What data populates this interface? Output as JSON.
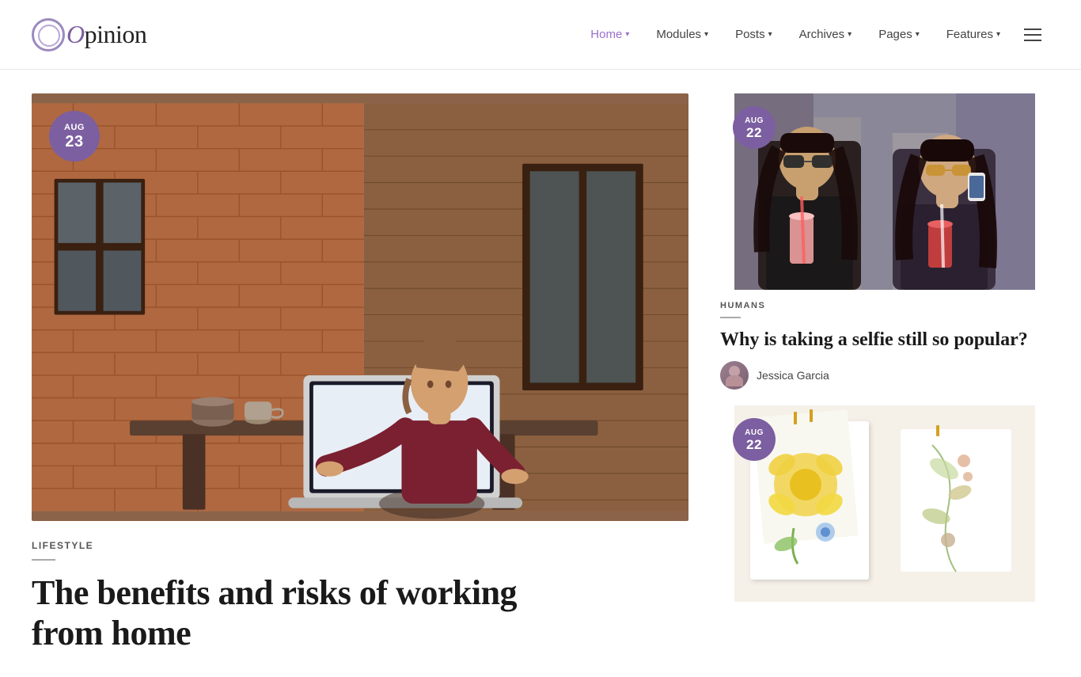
{
  "site": {
    "logo_text": "pinion",
    "logo_prefix": "O"
  },
  "nav": {
    "items": [
      {
        "label": "Home",
        "active": true,
        "has_arrow": true
      },
      {
        "label": "Modules",
        "active": false,
        "has_arrow": true
      },
      {
        "label": "Posts",
        "active": false,
        "has_arrow": true
      },
      {
        "label": "Archives",
        "active": false,
        "has_arrow": true
      },
      {
        "label": "Pages",
        "active": false,
        "has_arrow": true
      },
      {
        "label": "Features",
        "active": false,
        "has_arrow": true
      }
    ]
  },
  "featured": {
    "date_month": "AUG",
    "date_day": "23",
    "category": "LIFESTYLE",
    "title_line1": "The benefits and risks of working",
    "title_line2": "from home",
    "image_alt": "Woman working on laptop outdoors"
  },
  "sidebar": {
    "card1": {
      "date_month": "AUG",
      "date_day": "22",
      "category": "HUMANS",
      "title": "Why is taking a selfie still so popular?",
      "author_name": "Jessica Garcia",
      "image_alt": "Two women taking selfies"
    },
    "card2": {
      "date_month": "AUG",
      "date_day": "22",
      "image_alt": "Floral art pieces on white background"
    }
  },
  "colors": {
    "accent_purple": "#7c5fa0",
    "nav_active": "#9b6fcf"
  }
}
